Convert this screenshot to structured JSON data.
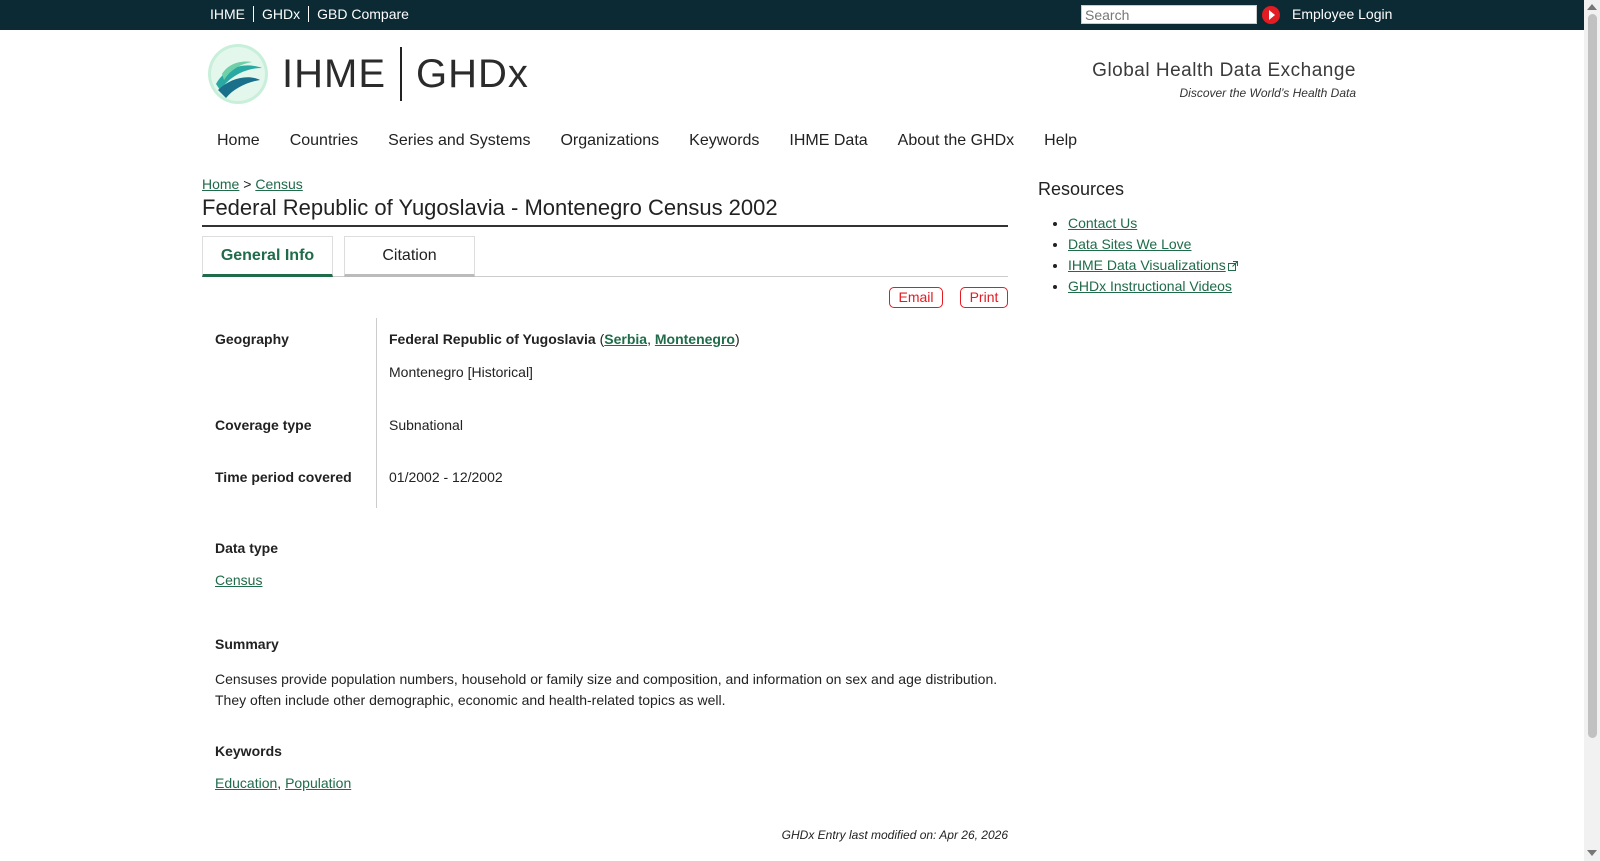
{
  "topbar": {
    "links": [
      "IHME",
      "GHDx",
      "GBD Compare"
    ],
    "search_placeholder": "Search",
    "employee_login": "Employee Login"
  },
  "header": {
    "logo_ihme": "IHME",
    "logo_ghdx": "GHDx",
    "tagline": "Global Health Data Exchange",
    "tagline_sub": "Discover the World’s Health Data"
  },
  "nav": [
    "Home",
    "Countries",
    "Series and Systems",
    "Organizations",
    "Keywords",
    "IHME Data",
    "About the GHDx",
    "Help"
  ],
  "breadcrumb": {
    "home": "Home",
    "sep": ">",
    "current": "Census"
  },
  "page_title": "Federal Republic of Yugoslavia - Montenegro Census 2002",
  "tabs": {
    "general": "General Info",
    "citation": "Citation"
  },
  "actions": {
    "email": "Email",
    "print": "Print"
  },
  "info": {
    "geography_label": "Geography",
    "geography_country": "Federal Republic of Yugoslavia",
    "geography_open": "(",
    "geography_link1": "Serbia",
    "geography_comma": ",",
    "geography_link2": "Montenegro",
    "geography_close": ")",
    "geography_sub": "Montenegro [Historical]",
    "coverage_label": "Coverage type",
    "coverage_value": "Subnational",
    "time_label": "Time period covered",
    "time_value": "01/2002 - 12/2002"
  },
  "data_type": {
    "label": "Data type",
    "value": "Census"
  },
  "summary": {
    "label": "Summary",
    "text": "Censuses provide population numbers, household or family size and composition, and information on sex and age distribution. They often include other demographic, economic and health-related topics as well."
  },
  "keywords": {
    "label": "Keywords",
    "kw1": "Education",
    "comma": ",",
    "kw2": "Population"
  },
  "modified": "GHDx Entry last modified on: Apr 26, 2026",
  "resources": {
    "title": "Resources",
    "items": [
      "Contact Us",
      "Data Sites We Love",
      "IHME Data Visualizations",
      "GHDx Instructional Videos"
    ]
  },
  "colors": {
    "topbar": "#0b2a33",
    "link": "#1f6b4a",
    "accent": "#e31b23"
  }
}
